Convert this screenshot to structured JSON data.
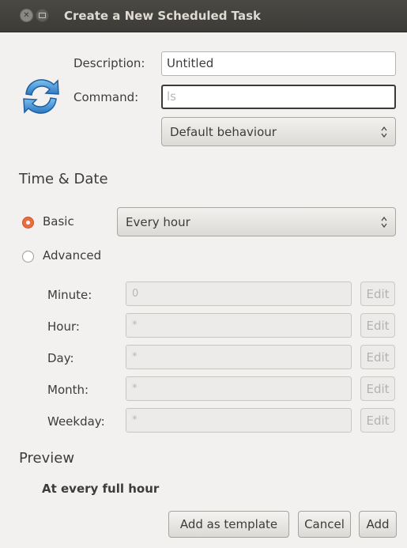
{
  "window": {
    "title": "Create a New Scheduled Task"
  },
  "task": {
    "description_label": "Description:",
    "description_value": "Untitled",
    "command_label": "Command:",
    "command_placeholder": "ls",
    "behaviour_selected": "Default behaviour"
  },
  "time_date": {
    "heading": "Time & Date",
    "basic_label": "Basic",
    "basic_selected": true,
    "basic_option_selected": "Every hour",
    "advanced_label": "Advanced",
    "fields": [
      {
        "label": "Minute:",
        "value": "0",
        "edit": "Edit"
      },
      {
        "label": "Hour:",
        "value": "*",
        "edit": "Edit"
      },
      {
        "label": "Day:",
        "value": "*",
        "edit": "Edit"
      },
      {
        "label": "Month:",
        "value": "*",
        "edit": "Edit"
      },
      {
        "label": "Weekday:",
        "value": "*",
        "edit": "Edit"
      }
    ]
  },
  "preview": {
    "heading": "Preview",
    "text": "At every full hour"
  },
  "buttons": {
    "add_template": "Add as template",
    "cancel": "Cancel",
    "add": "Add"
  },
  "icons": {
    "close": "close-icon",
    "minimize": "minimize-icon",
    "task": "refresh-icon"
  },
  "colors": {
    "titlebar": "#3c3b37",
    "radio_active": "#e66f42",
    "task_icon": "#3e8ed0"
  }
}
